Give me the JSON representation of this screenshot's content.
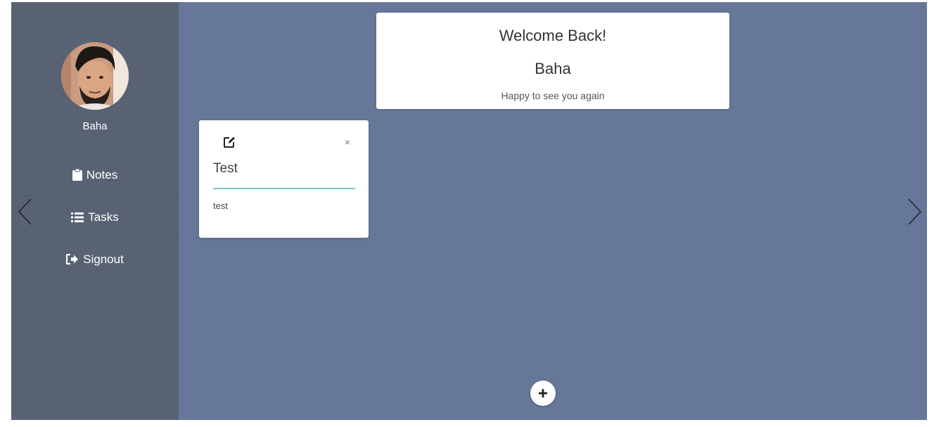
{
  "sidebar": {
    "username": "Baha",
    "items": [
      {
        "label": "Notes",
        "icon": "clipboard-icon"
      },
      {
        "label": "Tasks",
        "icon": "list-icon"
      },
      {
        "label": "Signout",
        "icon": "signout-icon"
      }
    ]
  },
  "welcome": {
    "title": "Welcome Back!",
    "name": "Baha",
    "subtitle": "Happy to see you again"
  },
  "notes": [
    {
      "title": "Test",
      "body": "test"
    }
  ],
  "controls": {
    "close_label": "×",
    "add_label": "+"
  },
  "colors": {
    "background": "#66779a",
    "sidebar": "#596273",
    "card": "#ffffff",
    "accent_line": "#7ec6c6"
  }
}
